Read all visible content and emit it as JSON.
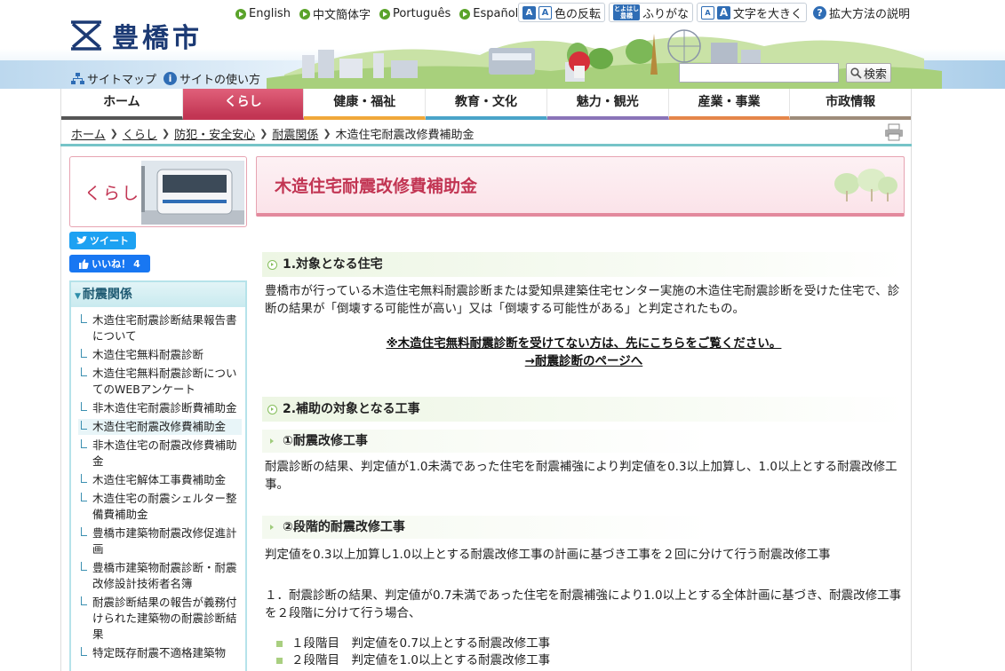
{
  "header": {
    "logo_text": "豊橋市",
    "languages": [
      "English",
      "中文簡体字",
      "Português",
      "Español"
    ],
    "tools": {
      "color_label": "色の反転",
      "color_icon_a": "A",
      "color_icon_b": "A",
      "furigana_icon_line1": "とよはし",
      "furigana_icon_line2": "豊橋",
      "furigana_label": "ふりがな",
      "enlarge_icon_a": "A",
      "enlarge_icon_b": "A",
      "enlarge_label": "文字を大きく",
      "help_icon": "?",
      "help_label": "拡大方法の説明"
    },
    "sitemap_label": "サイトマップ",
    "usage_icon": "i",
    "usage_label": "サイトの使い方",
    "search_placeholder": "",
    "search_button": "検索"
  },
  "nav": {
    "items": [
      "ホーム",
      "くらし",
      "健康・福祉",
      "教育・文化",
      "魅力・観光",
      "産業・事業",
      "市政情報"
    ],
    "colors": [
      "#555555",
      "#c23553",
      "#f0a83a",
      "#4aa4c9",
      "#8a74b8",
      "#e5864a",
      "#9e8c7a"
    ]
  },
  "breadcrumb": {
    "items": [
      "ホーム",
      "くらし",
      "防犯・安全安心",
      "耐震関係"
    ],
    "current": "木造住宅耐震改修費補助金"
  },
  "sidebar": {
    "banner_title": "くらし",
    "tweet_label": "ツイート",
    "like_label": "いいね！",
    "like_count": "4",
    "section_title": "耐震関係",
    "items": [
      "木造住宅耐震診断結果報告書について",
      "木造住宅無料耐震診断",
      "木造住宅無料耐震診断についてのWEBアンケート",
      "非木造住宅耐震診断費補助金",
      "木造住宅耐震改修費補助金",
      "非木造住宅の耐震改修費補助金",
      "木造住宅解体工事費補助金",
      "木造住宅の耐震シェルター整備費補助金",
      "豊橋市建築物耐震改修促進計画",
      "豊橋市建築物耐震診断・耐震改修設計技術者名簿",
      "耐震診断結果の報告が義務付けられた建築物の耐震診断結果",
      "特定既存耐震不適格建築物"
    ]
  },
  "main": {
    "title": "木造住宅耐震改修費補助金",
    "section1": {
      "heading": "1.対象となる住宅",
      "text": "豊橋市が行っている木造住宅無料耐震診断または愛知県建築住宅センター実施の木造住宅耐震診断を受けた住宅で、診断の結果が「倒壊する可能性が高い」又は「倒壊する可能性がある」と判定されたもの。",
      "link1": "※木造住宅無料耐震診断を受けてない方は、先にこちらをご覧ください。",
      "link2": "→耐震診断のページへ"
    },
    "section2": {
      "heading": "2.補助の対象となる工事",
      "sub1_heading": "①耐震改修工事",
      "sub1_text": "耐震診断の結果、判定値が1.0未満であった住宅を耐震補強により判定値を0.3以上加算し、1.0以上とする耐震改修工事。",
      "sub2_heading": "②段階的耐震改修工事",
      "sub2_text": "判定値を0.3以上加算し1.0以上とする耐震改修工事の計画に基づき工事を２回に分けて行う耐震改修工事",
      "item1": "１．耐震診断の結果、判定値が0.7未満であった住宅を耐震補強により1.0以上とする全体計画に基づき、耐震改修工事を２段階に分けて行う場合、",
      "bullets": [
        "１段階目　判定値を0.7以上とする耐震改修工事",
        "２段階目　判定値を1.0以上とする耐震改修工事"
      ]
    }
  }
}
